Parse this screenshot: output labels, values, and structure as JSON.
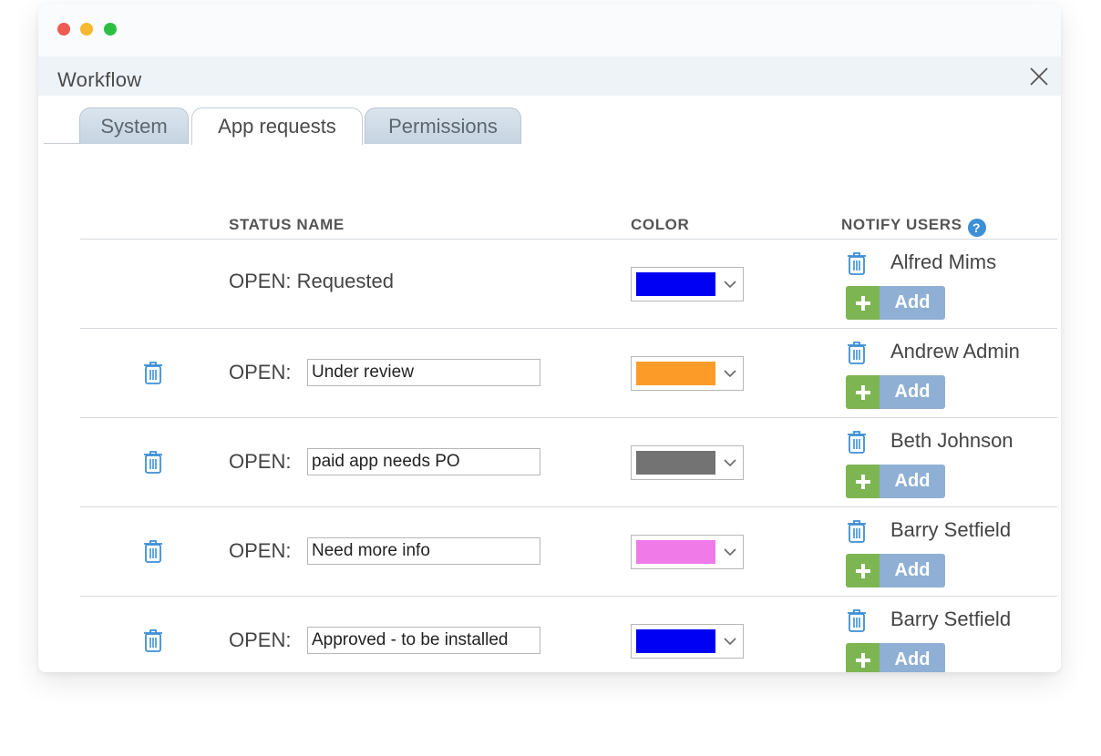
{
  "dialog": {
    "title": "Workflow"
  },
  "tabs": [
    {
      "label": "System"
    },
    {
      "label": "App requests"
    },
    {
      "label": "Permissions"
    }
  ],
  "columns": {
    "status_name": "STATUS NAME",
    "color": "COLOR",
    "notify_users": "NOTIFY USERS",
    "help_glyph": "?"
  },
  "add_label": "Add",
  "rows": [
    {
      "prefix": "OPEN:",
      "name": "Requested",
      "static_label": "OPEN: Requested",
      "color": "#0000f5",
      "user": "Alfred Mims"
    },
    {
      "prefix": "OPEN:",
      "name": "Under review",
      "color": "#fc9b27",
      "user": "Andrew Admin"
    },
    {
      "prefix": "OPEN:",
      "name": "paid app needs PO",
      "color": "#737373",
      "user": "Beth Johnson"
    },
    {
      "prefix": "OPEN:",
      "name": "Need more info",
      "color": "#f07be8",
      "user": "Barry Setfield"
    },
    {
      "prefix": "OPEN:",
      "name": "Approved - to be installed",
      "color": "#0000f5",
      "user": "Barry Setfield"
    }
  ]
}
